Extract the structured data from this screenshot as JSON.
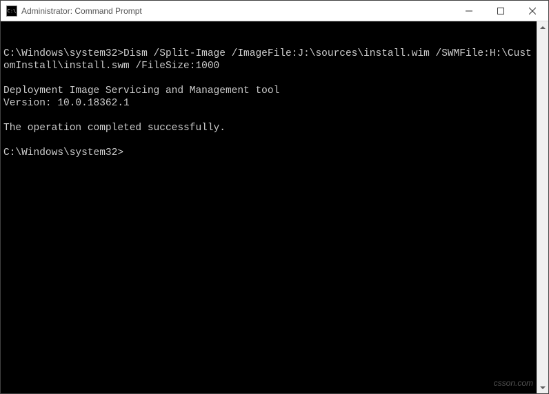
{
  "titlebar": {
    "icon_glyph": "C:\\",
    "title": "Administrator: Command Prompt"
  },
  "terminal": {
    "prompt1": "C:\\Windows\\system32>",
    "command": "Dism /Split-Image /ImageFile:J:\\sources\\install.wim /SWMFile:H:\\CustomInstall\\install.swm /FileSize:1000",
    "blank1": "",
    "tool_line": "Deployment Image Servicing and Management tool",
    "version_line": "Version: 10.0.18362.1",
    "blank2": "",
    "success_line": "The operation completed successfully.",
    "blank3": "",
    "prompt2": "C:\\Windows\\system32>"
  },
  "watermark": "csson.com"
}
